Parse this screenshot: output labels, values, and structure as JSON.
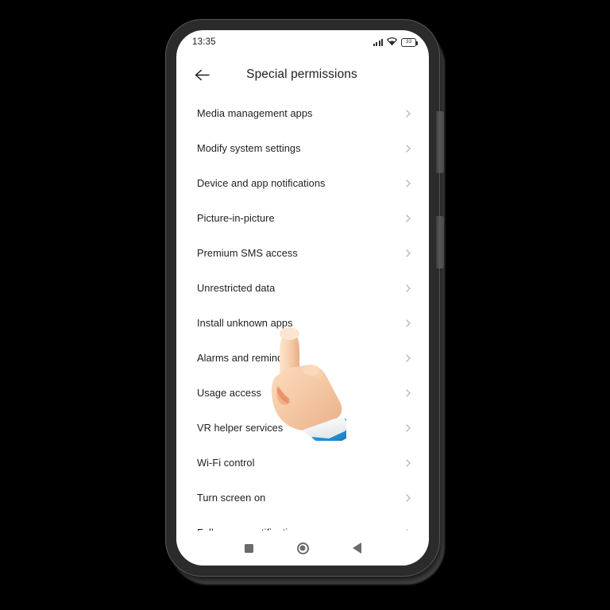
{
  "device": {
    "frame_color": "#2b2b2b",
    "screen_background": "#ffffff"
  },
  "status_bar": {
    "time": "13:35",
    "signal_icon": "signal-bars-icon",
    "wifi_icon": "wifi-icon",
    "battery_icon": "battery-icon",
    "battery_level": "33"
  },
  "app_bar": {
    "back_icon": "back-arrow-icon",
    "title": "Special permissions"
  },
  "list": {
    "chevron_icon": "chevron-right-icon",
    "items": [
      {
        "label": "Media management apps"
      },
      {
        "label": "Modify system settings"
      },
      {
        "label": "Device and app notifications"
      },
      {
        "label": "Picture-in-picture"
      },
      {
        "label": "Premium SMS access"
      },
      {
        "label": "Unrestricted data"
      },
      {
        "label": "Install unknown apps"
      },
      {
        "label": "Alarms and reminders"
      },
      {
        "label": "Usage access"
      },
      {
        "label": "VR helper services"
      },
      {
        "label": "Wi-Fi control"
      },
      {
        "label": "Turn screen on"
      },
      {
        "label": "Full screen notifications"
      }
    ]
  },
  "nav_bar": {
    "recent_apps_icon": "square-recents-icon",
    "home_icon": "circle-home-icon",
    "back_icon": "triangle-back-icon"
  },
  "cursor": {
    "icon": "pointing-hand-cursor-icon",
    "skin_color": "#f3c6a3",
    "cuff_color": "#f2f2f2",
    "sleeve_color": "#2493d6"
  },
  "hardware": {
    "volume_button": "volume-rocker-button",
    "power_button": "power-button"
  }
}
